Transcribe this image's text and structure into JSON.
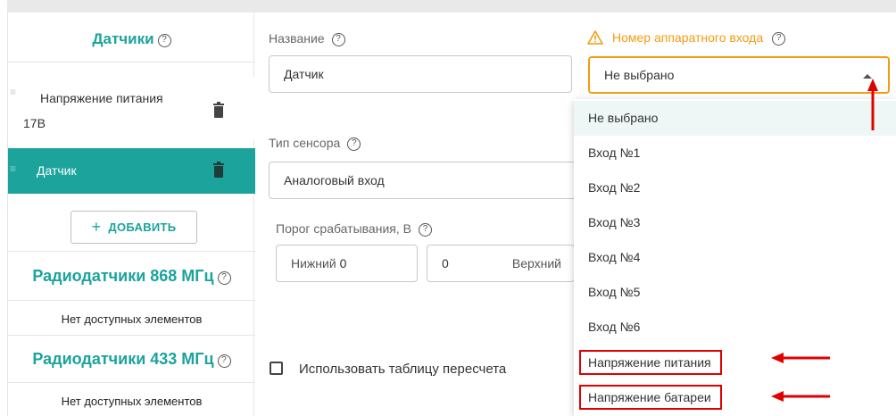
{
  "sidebar": {
    "sensors_title": "Датчики",
    "help_glyph": "?",
    "items": [
      {
        "name": "Напряжение питания",
        "value": "17В",
        "active": false
      },
      {
        "name": "Датчик",
        "value": "",
        "active": true
      }
    ],
    "add_button": "ДОБАВИТЬ",
    "add_plus": "+",
    "radio868_title": "Радиодатчики 868 МГц",
    "radio868_empty": "Нет доступных элементов",
    "radio433_title": "Радиодатчики 433 МГц",
    "radio433_empty": "Нет доступных элементов"
  },
  "form": {
    "name_label": "Название",
    "name_value": "Датчик",
    "sensor_type_label": "Тип сенсора",
    "sensor_type_value": "Аналоговый вход",
    "threshold_label": "Порог срабатывания, В",
    "lower_label": "Нижний",
    "lower_value": "0",
    "upper_value": "0",
    "upper_label": "Верхний",
    "hw_input_label": "Номер аппаратного входа",
    "hw_input_value": "Не выбрано",
    "use_table_label": "Использовать таблицу пересчета"
  },
  "dropdown": {
    "options": [
      "Не выбрано",
      "Вход №1",
      "Вход №2",
      "Вход №3",
      "Вход №4",
      "Вход №5",
      "Вход №6",
      "Напряжение питания",
      "Напряжение батареи"
    ],
    "selected_index": 0,
    "highlighted_indices": [
      7,
      8
    ]
  },
  "colors": {
    "accent": "#1ba39c",
    "warning": "#f39c12",
    "annotation": "#e00000"
  }
}
